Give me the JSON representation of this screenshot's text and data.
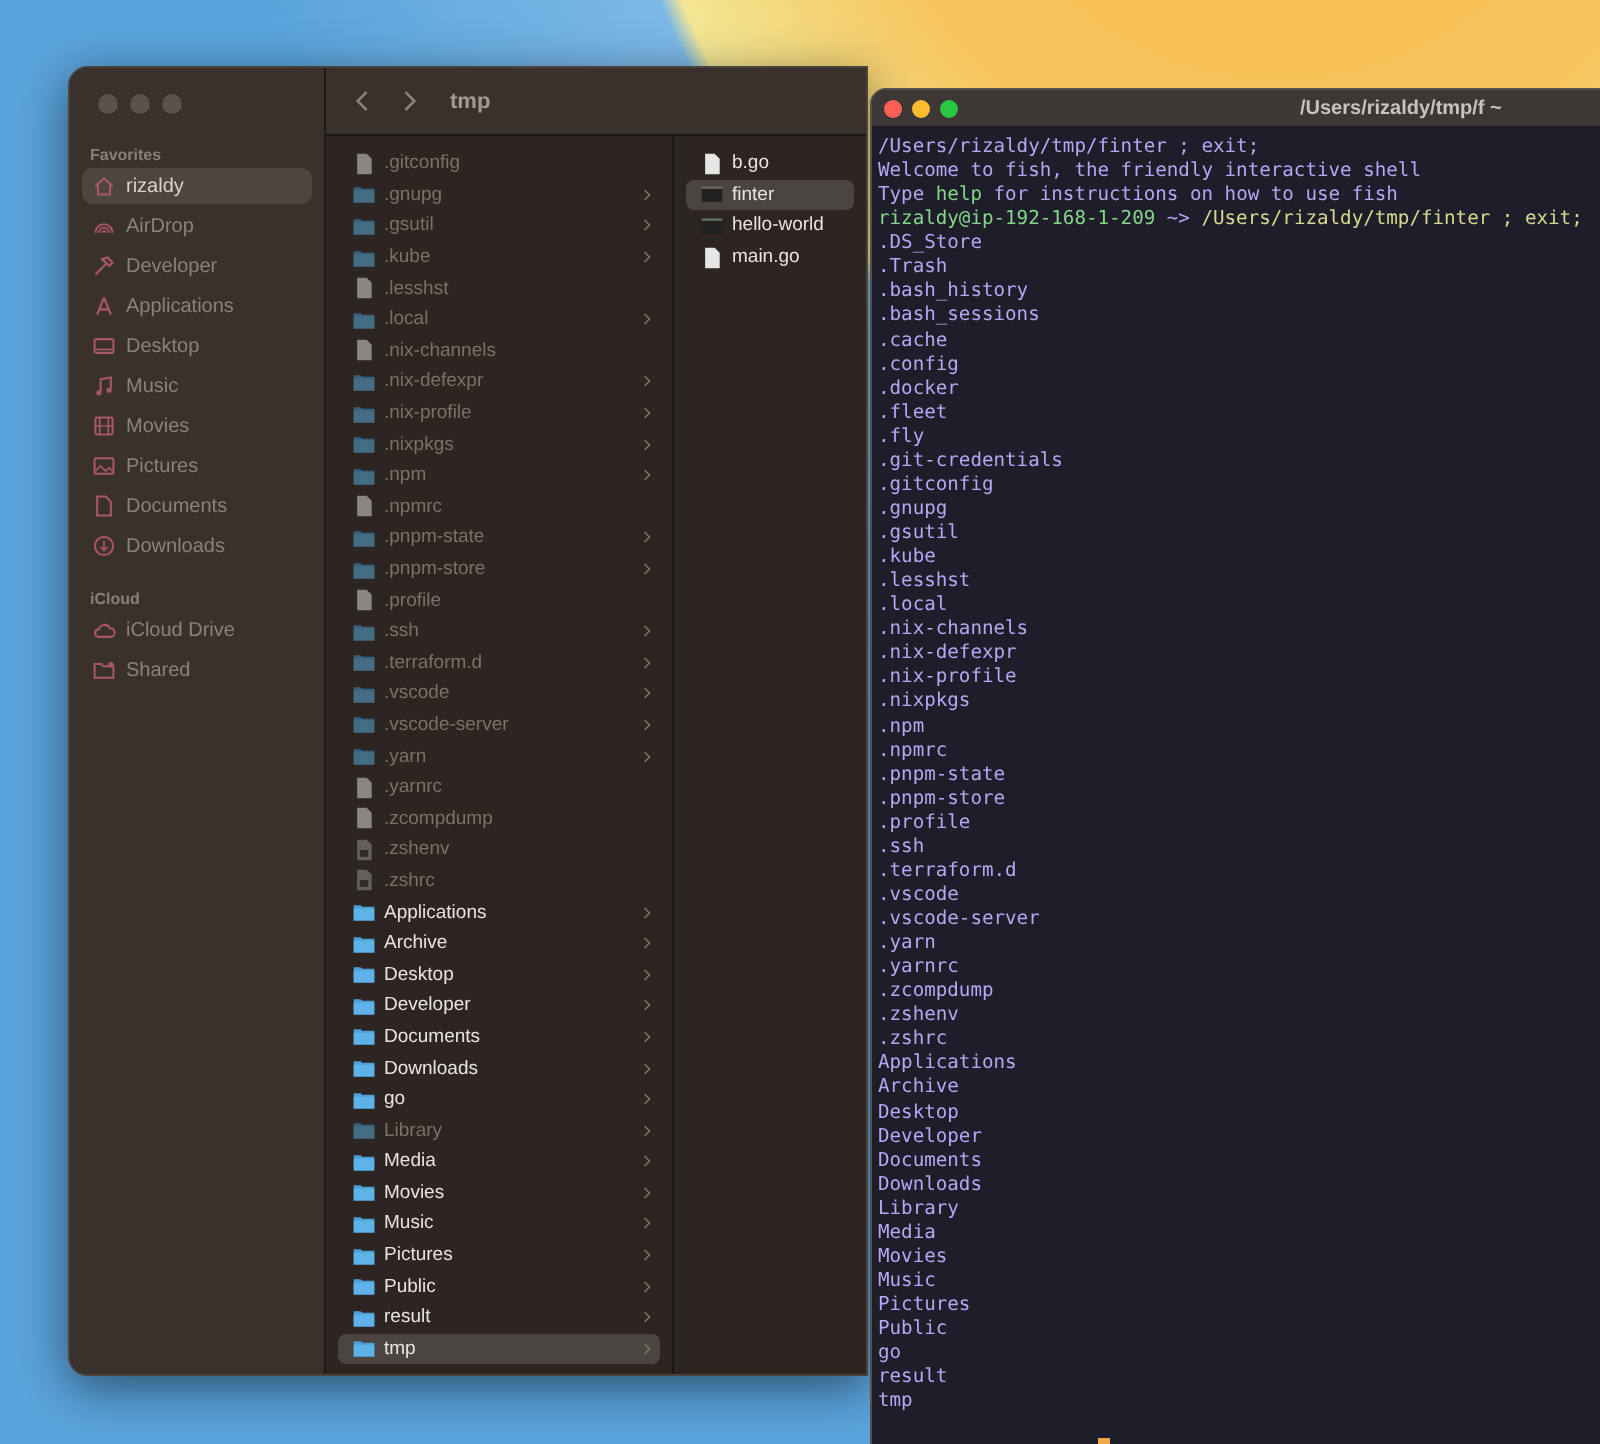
{
  "finder": {
    "title": "tmp",
    "sidebar": [
      {
        "heading": "Favorites",
        "items": [
          {
            "label": "rizaldy",
            "kind": "home",
            "selected": true
          },
          {
            "label": "AirDrop",
            "kind": "airdrop",
            "selected": false
          },
          {
            "label": "Developer",
            "kind": "hammer",
            "selected": false
          },
          {
            "label": "Applications",
            "kind": "apps",
            "selected": false
          },
          {
            "label": "Desktop",
            "kind": "desktop",
            "selected": false
          },
          {
            "label": "Music",
            "kind": "music",
            "selected": false
          },
          {
            "label": "Movies",
            "kind": "movies",
            "selected": false
          },
          {
            "label": "Pictures",
            "kind": "pictures",
            "selected": false
          },
          {
            "label": "Documents",
            "kind": "document",
            "selected": false
          },
          {
            "label": "Downloads",
            "kind": "download",
            "selected": false
          }
        ]
      },
      {
        "heading": "iCloud",
        "items": [
          {
            "label": "iCloud Drive",
            "kind": "cloud",
            "selected": false
          },
          {
            "label": "Shared",
            "kind": "shared",
            "selected": false
          }
        ]
      }
    ],
    "columns": [
      [
        {
          "name": ".gitconfig",
          "kind": "file",
          "dimmed": true,
          "selected": false
        },
        {
          "name": ".gnupg",
          "kind": "folder",
          "dimmed": true,
          "selected": false
        },
        {
          "name": ".gsutil",
          "kind": "folder",
          "dimmed": true,
          "selected": false
        },
        {
          "name": ".kube",
          "kind": "folder",
          "dimmed": true,
          "selected": false
        },
        {
          "name": ".lesshst",
          "kind": "file",
          "dimmed": true,
          "selected": false
        },
        {
          "name": ".local",
          "kind": "folder",
          "dimmed": true,
          "selected": false
        },
        {
          "name": ".nix-channels",
          "kind": "file",
          "dimmed": true,
          "selected": false
        },
        {
          "name": ".nix-defexpr",
          "kind": "folder",
          "dimmed": true,
          "selected": false
        },
        {
          "name": ".nix-profile",
          "kind": "folder",
          "dimmed": true,
          "selected": false
        },
        {
          "name": ".nixpkgs",
          "kind": "folder",
          "dimmed": true,
          "selected": false
        },
        {
          "name": ".npm",
          "kind": "folder",
          "dimmed": true,
          "selected": false
        },
        {
          "name": ".npmrc",
          "kind": "file",
          "dimmed": true,
          "selected": false
        },
        {
          "name": ".pnpm-state",
          "kind": "folder",
          "dimmed": true,
          "selected": false
        },
        {
          "name": ".pnpm-store",
          "kind": "folder",
          "dimmed": true,
          "selected": false
        },
        {
          "name": ".profile",
          "kind": "file",
          "dimmed": true,
          "selected": false
        },
        {
          "name": ".ssh",
          "kind": "folder",
          "dimmed": true,
          "selected": false
        },
        {
          "name": ".terraform.d",
          "kind": "folder",
          "dimmed": true,
          "selected": false
        },
        {
          "name": ".vscode",
          "kind": "folder",
          "dimmed": true,
          "selected": false
        },
        {
          "name": ".vscode-server",
          "kind": "folder",
          "dimmed": true,
          "selected": false
        },
        {
          "name": ".yarn",
          "kind": "folder",
          "dimmed": true,
          "selected": false
        },
        {
          "name": ".yarnrc",
          "kind": "file",
          "dimmed": true,
          "selected": false
        },
        {
          "name": ".zcompdump",
          "kind": "file",
          "dimmed": true,
          "selected": false
        },
        {
          "name": ".zshenv",
          "kind": "script",
          "dimmed": true,
          "selected": false
        },
        {
          "name": ".zshrc",
          "kind": "script",
          "dimmed": true,
          "selected": false
        },
        {
          "name": "Applications",
          "kind": "folder",
          "dimmed": false,
          "selected": false
        },
        {
          "name": "Archive",
          "kind": "folder",
          "dimmed": false,
          "selected": false
        },
        {
          "name": "Desktop",
          "kind": "folder",
          "dimmed": false,
          "selected": false
        },
        {
          "name": "Developer",
          "kind": "folder",
          "dimmed": false,
          "selected": false
        },
        {
          "name": "Documents",
          "kind": "folder",
          "dimmed": false,
          "selected": false
        },
        {
          "name": "Downloads",
          "kind": "folder",
          "dimmed": false,
          "selected": false
        },
        {
          "name": "go",
          "kind": "folder",
          "dimmed": false,
          "selected": false
        },
        {
          "name": "Library",
          "kind": "folder",
          "dimmed": true,
          "selected": false
        },
        {
          "name": "Media",
          "kind": "folder",
          "dimmed": false,
          "selected": false
        },
        {
          "name": "Movies",
          "kind": "folder",
          "dimmed": false,
          "selected": false
        },
        {
          "name": "Music",
          "kind": "folder",
          "dimmed": false,
          "selected": false
        },
        {
          "name": "Pictures",
          "kind": "folder",
          "dimmed": false,
          "selected": false
        },
        {
          "name": "Public",
          "kind": "folder",
          "dimmed": false,
          "selected": false
        },
        {
          "name": "result",
          "kind": "folder",
          "dimmed": false,
          "selected": false
        },
        {
          "name": "tmp",
          "kind": "folder",
          "dimmed": false,
          "selected": true
        }
      ],
      [
        {
          "name": "b.go",
          "kind": "file",
          "dimmed": false,
          "selected": false
        },
        {
          "name": "finter",
          "kind": "exec",
          "dimmed": false,
          "selected": true
        },
        {
          "name": "hello-world",
          "kind": "exec",
          "dimmed": false,
          "selected": false
        },
        {
          "name": "main.go",
          "kind": "file",
          "dimmed": false,
          "selected": false
        }
      ]
    ]
  },
  "terminal": {
    "title": "/Users/rizaldy/tmp/f ~",
    "header_lines": [
      [
        {
          "text": "/Users/rizaldy/tmp/finter ; exit;",
          "kind": "output"
        }
      ],
      [
        {
          "text": "Welcome to fish, the friendly interactive shell",
          "kind": "output"
        }
      ],
      [
        {
          "text": "Type ",
          "kind": "output"
        },
        {
          "text": "help",
          "kind": "keyword"
        },
        {
          "text": " for instructions on how to use fish",
          "kind": "output"
        }
      ],
      [
        {
          "text": "rizaldy@ip-192-168-1-209",
          "kind": "prompt"
        },
        {
          "text": " ~> ",
          "kind": "output"
        },
        {
          "text": "/Users/rizaldy/tmp/finter ; exit;",
          "kind": "command"
        }
      ]
    ],
    "listing": [
      ".DS_Store",
      ".Trash",
      ".bash_history",
      ".bash_sessions",
      ".cache",
      ".config",
      ".docker",
      ".fleet",
      ".fly",
      ".git-credentials",
      ".gitconfig",
      ".gnupg",
      ".gsutil",
      ".kube",
      ".lesshst",
      ".local",
      ".nix-channels",
      ".nix-defexpr",
      ".nix-profile",
      ".nixpkgs",
      ".npm",
      ".npmrc",
      ".pnpm-state",
      ".pnpm-store",
      ".profile",
      ".ssh",
      ".terraform.d",
      ".vscode",
      ".vscode-server",
      ".yarn",
      ".yarnrc",
      ".zcompdump",
      ".zshenv",
      ".zshrc",
      "Applications",
      "Archive",
      "Desktop",
      "Developer",
      "Documents",
      "Downloads",
      "Library",
      "Media",
      "Movies",
      "Music",
      "Pictures",
      "Public",
      "go",
      "result",
      "tmp"
    ]
  }
}
